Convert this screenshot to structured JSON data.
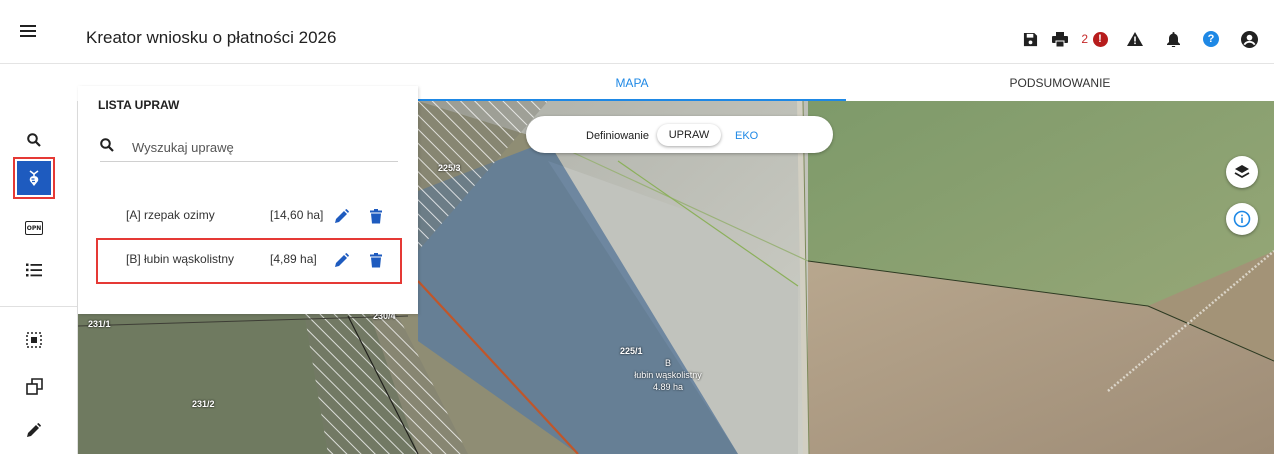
{
  "header": {
    "menu_icon": "hamburger-menu-icon",
    "title": "Kreator wniosku o płatności 2026",
    "error_count": "2",
    "error_badge": "!",
    "help_badge": "?"
  },
  "tabs": [
    {
      "label": "MAPA",
      "active": true
    },
    {
      "label": "PODSUMOWANIE",
      "active": false
    }
  ],
  "sidebar": {
    "items": [
      {
        "name": "search-icon"
      },
      {
        "name": "crop-icon",
        "selected": true
      },
      {
        "name": "opn-icon",
        "text": "OPN"
      },
      {
        "name": "list-icon"
      },
      {
        "name": "select-area-icon"
      },
      {
        "name": "layers-copy-icon"
      },
      {
        "name": "pencil-icon"
      }
    ]
  },
  "crop_list": {
    "title": "LISTA UPRAW",
    "search_placeholder": "Wyszukaj uprawę",
    "items": [
      {
        "name": "[A] rzepak ozimy",
        "area": "[14,60 ha]",
        "highlighted": false
      },
      {
        "name": "[B] łubin wąskolistny",
        "area": "[4,89 ha]",
        "highlighted": true
      }
    ]
  },
  "definition_toggle": {
    "label": "Definiowanie",
    "option_upraw": "UPRAW",
    "option_eko": "EKO"
  },
  "map": {
    "parcel_labels": [
      "225/3",
      "231/1",
      "230/4",
      "231/2"
    ],
    "crop_label": {
      "parcel": "225/1",
      "code": "B",
      "crop": "łubin wąskolistny",
      "area": "4.89 ha"
    }
  },
  "colors": {
    "accent": "#1e88e5",
    "selected_tool": "#1e5bbf",
    "highlight_border": "#e53935",
    "error": "#b71c1c"
  }
}
